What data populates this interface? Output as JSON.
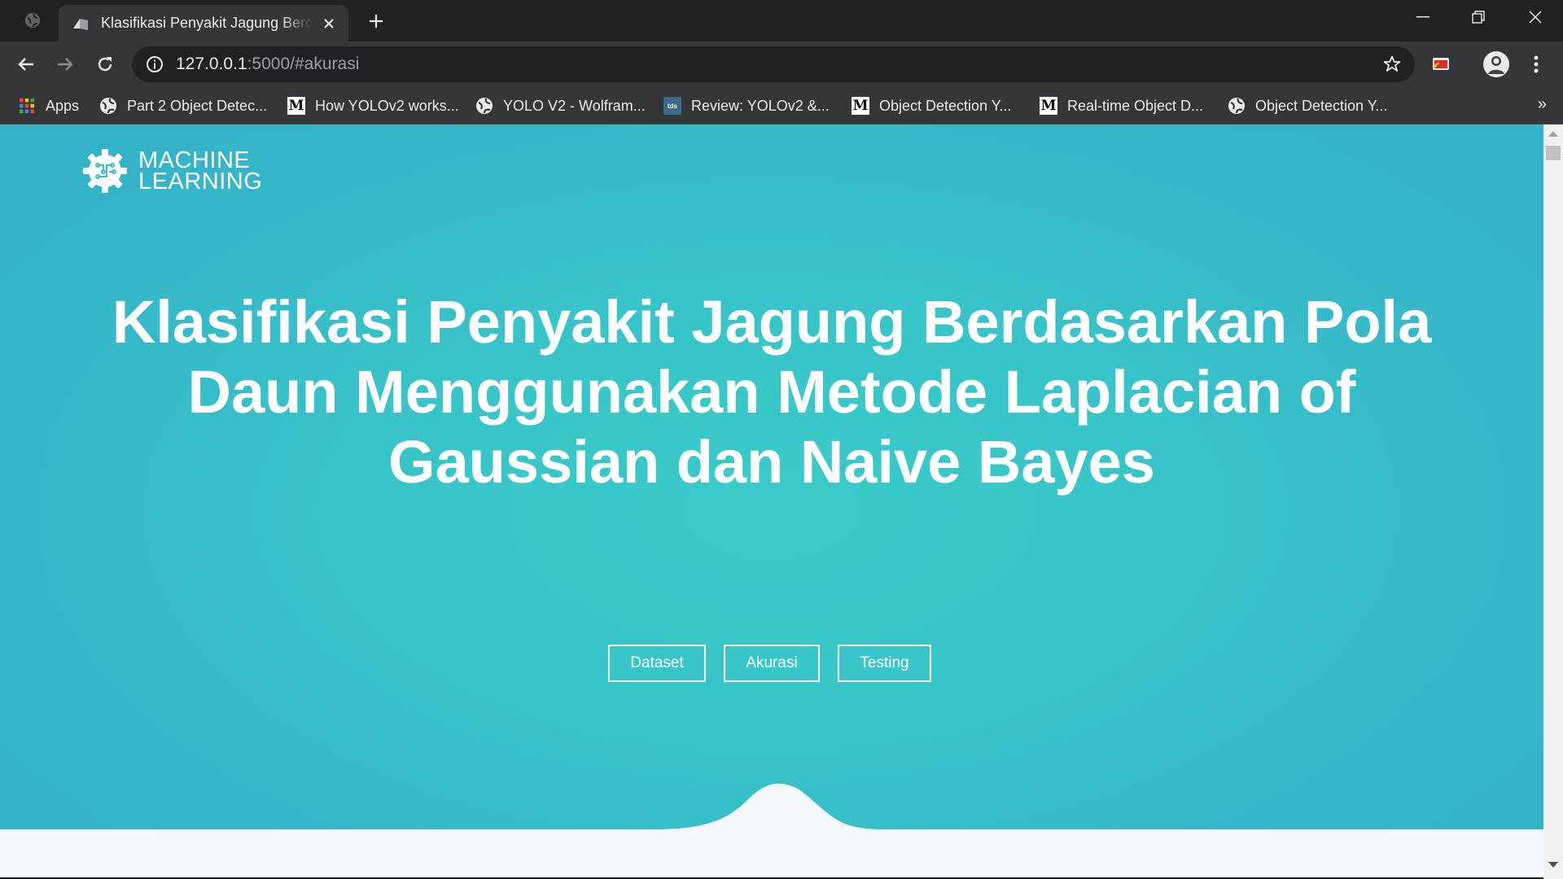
{
  "browser": {
    "tab": {
      "title": "Klasifikasi Penyakit Jagung Berdasarkan Pola Daun"
    },
    "address": {
      "host": "127.0.0.1",
      "path": ":5000/#akurasi"
    },
    "bookmarks": [
      {
        "label": "Apps",
        "icon": "apps-grid-icon"
      },
      {
        "label": "Part 2 Object Detec...",
        "icon": "globe-icon"
      },
      {
        "label": "How YOLOv2 works...",
        "icon": "medium-icon"
      },
      {
        "label": "YOLO V2 - Wolfram...",
        "icon": "globe-icon"
      },
      {
        "label": "Review: YOLOv2 &...",
        "icon": "tds-icon"
      },
      {
        "label": "Object Detection Y...",
        "icon": "medium-icon"
      },
      {
        "label": "Real-time Object D...",
        "icon": "medium-icon"
      },
      {
        "label": "Object Detection Y...",
        "icon": "globe-icon"
      }
    ],
    "bookmarks_more": "»",
    "medium_glyph": "M",
    "tds_glyph": "tds"
  },
  "page": {
    "logo": {
      "line1": "MACHINE",
      "line2": "LEARNING"
    },
    "headline": "Klasifikasi Penyakit Jagung Berdasarkan Pola Daun Menggunakan Metode Laplacian of Gaussian dan Naive Bayes",
    "buttons": {
      "dataset": "Dataset",
      "akurasi": "Akurasi",
      "testing": "Testing"
    }
  },
  "colors": {
    "hero_center": "#3acbc9",
    "hero_edge": "#34b2c8",
    "chrome_dark": "#202124",
    "chrome_toolbar": "#35363a"
  }
}
